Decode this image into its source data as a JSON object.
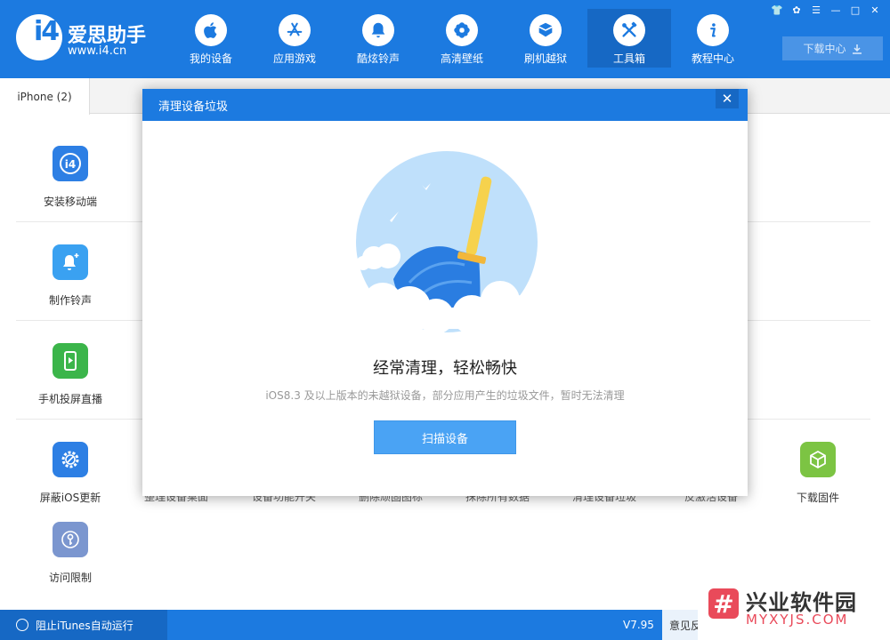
{
  "header": {
    "brand_name": "爱思助手",
    "brand_url": "www.i4.cn",
    "logo_text": "i4",
    "nav": [
      {
        "label": "我的设备",
        "icon": "apple-icon"
      },
      {
        "label": "应用游戏",
        "icon": "app-store-icon"
      },
      {
        "label": "酷炫铃声",
        "icon": "bell-icon"
      },
      {
        "label": "高清壁纸",
        "icon": "flower-icon"
      },
      {
        "label": "刷机越狱",
        "icon": "box-icon"
      },
      {
        "label": "工具箱",
        "icon": "tools-icon",
        "active": true
      },
      {
        "label": "教程中心",
        "icon": "info-icon"
      }
    ],
    "download_center": "下载中心"
  },
  "tabs": [
    {
      "label": "iPhone (2)"
    }
  ],
  "tools": [
    {
      "label": "安装移动端",
      "icon": "i4-app-icon",
      "color": "#2d7fe4"
    },
    {
      "label": "制作铃声",
      "icon": "bell-plus-icon",
      "color": "#3aa1f1"
    },
    {
      "label": "手机投屏直播",
      "icon": "screen-cast-icon",
      "color": "#3bb54a"
    },
    {
      "label": "屏蔽iOS更新",
      "icon": "gear-block-icon",
      "color": "#2d7fe4"
    },
    {
      "label": "下载固件",
      "icon": "cube-icon",
      "color": "#7cc443"
    },
    {
      "label": "访问限制",
      "icon": "key-icon",
      "color": "#7b96cf"
    }
  ],
  "hidden_tool_labels": [
    "整理设备桌面",
    "设备功能开关",
    "删除顽固图标",
    "抹除所有数据",
    "清理设备垃圾",
    "反激活设备"
  ],
  "dialog": {
    "title": "清理设备垃圾",
    "close": "✕",
    "heading": "经常清理，轻松畅快",
    "description": "iOS8.3 及以上版本的未越狱设备，部分应用产生的垃圾文件，暂时无法清理",
    "scan_button": "扫描设备"
  },
  "status": {
    "itunes_label": "阻止iTunes自动运行",
    "version": "V7.95",
    "feedback": "意见反"
  },
  "watermark": {
    "logo_char": "#",
    "title": "兴业软件园",
    "url": "MYXYJS.COM"
  },
  "colors": {
    "primary": "#1c7ae0",
    "primary_dark": "#1668c4",
    "button": "#4aa3f4"
  }
}
